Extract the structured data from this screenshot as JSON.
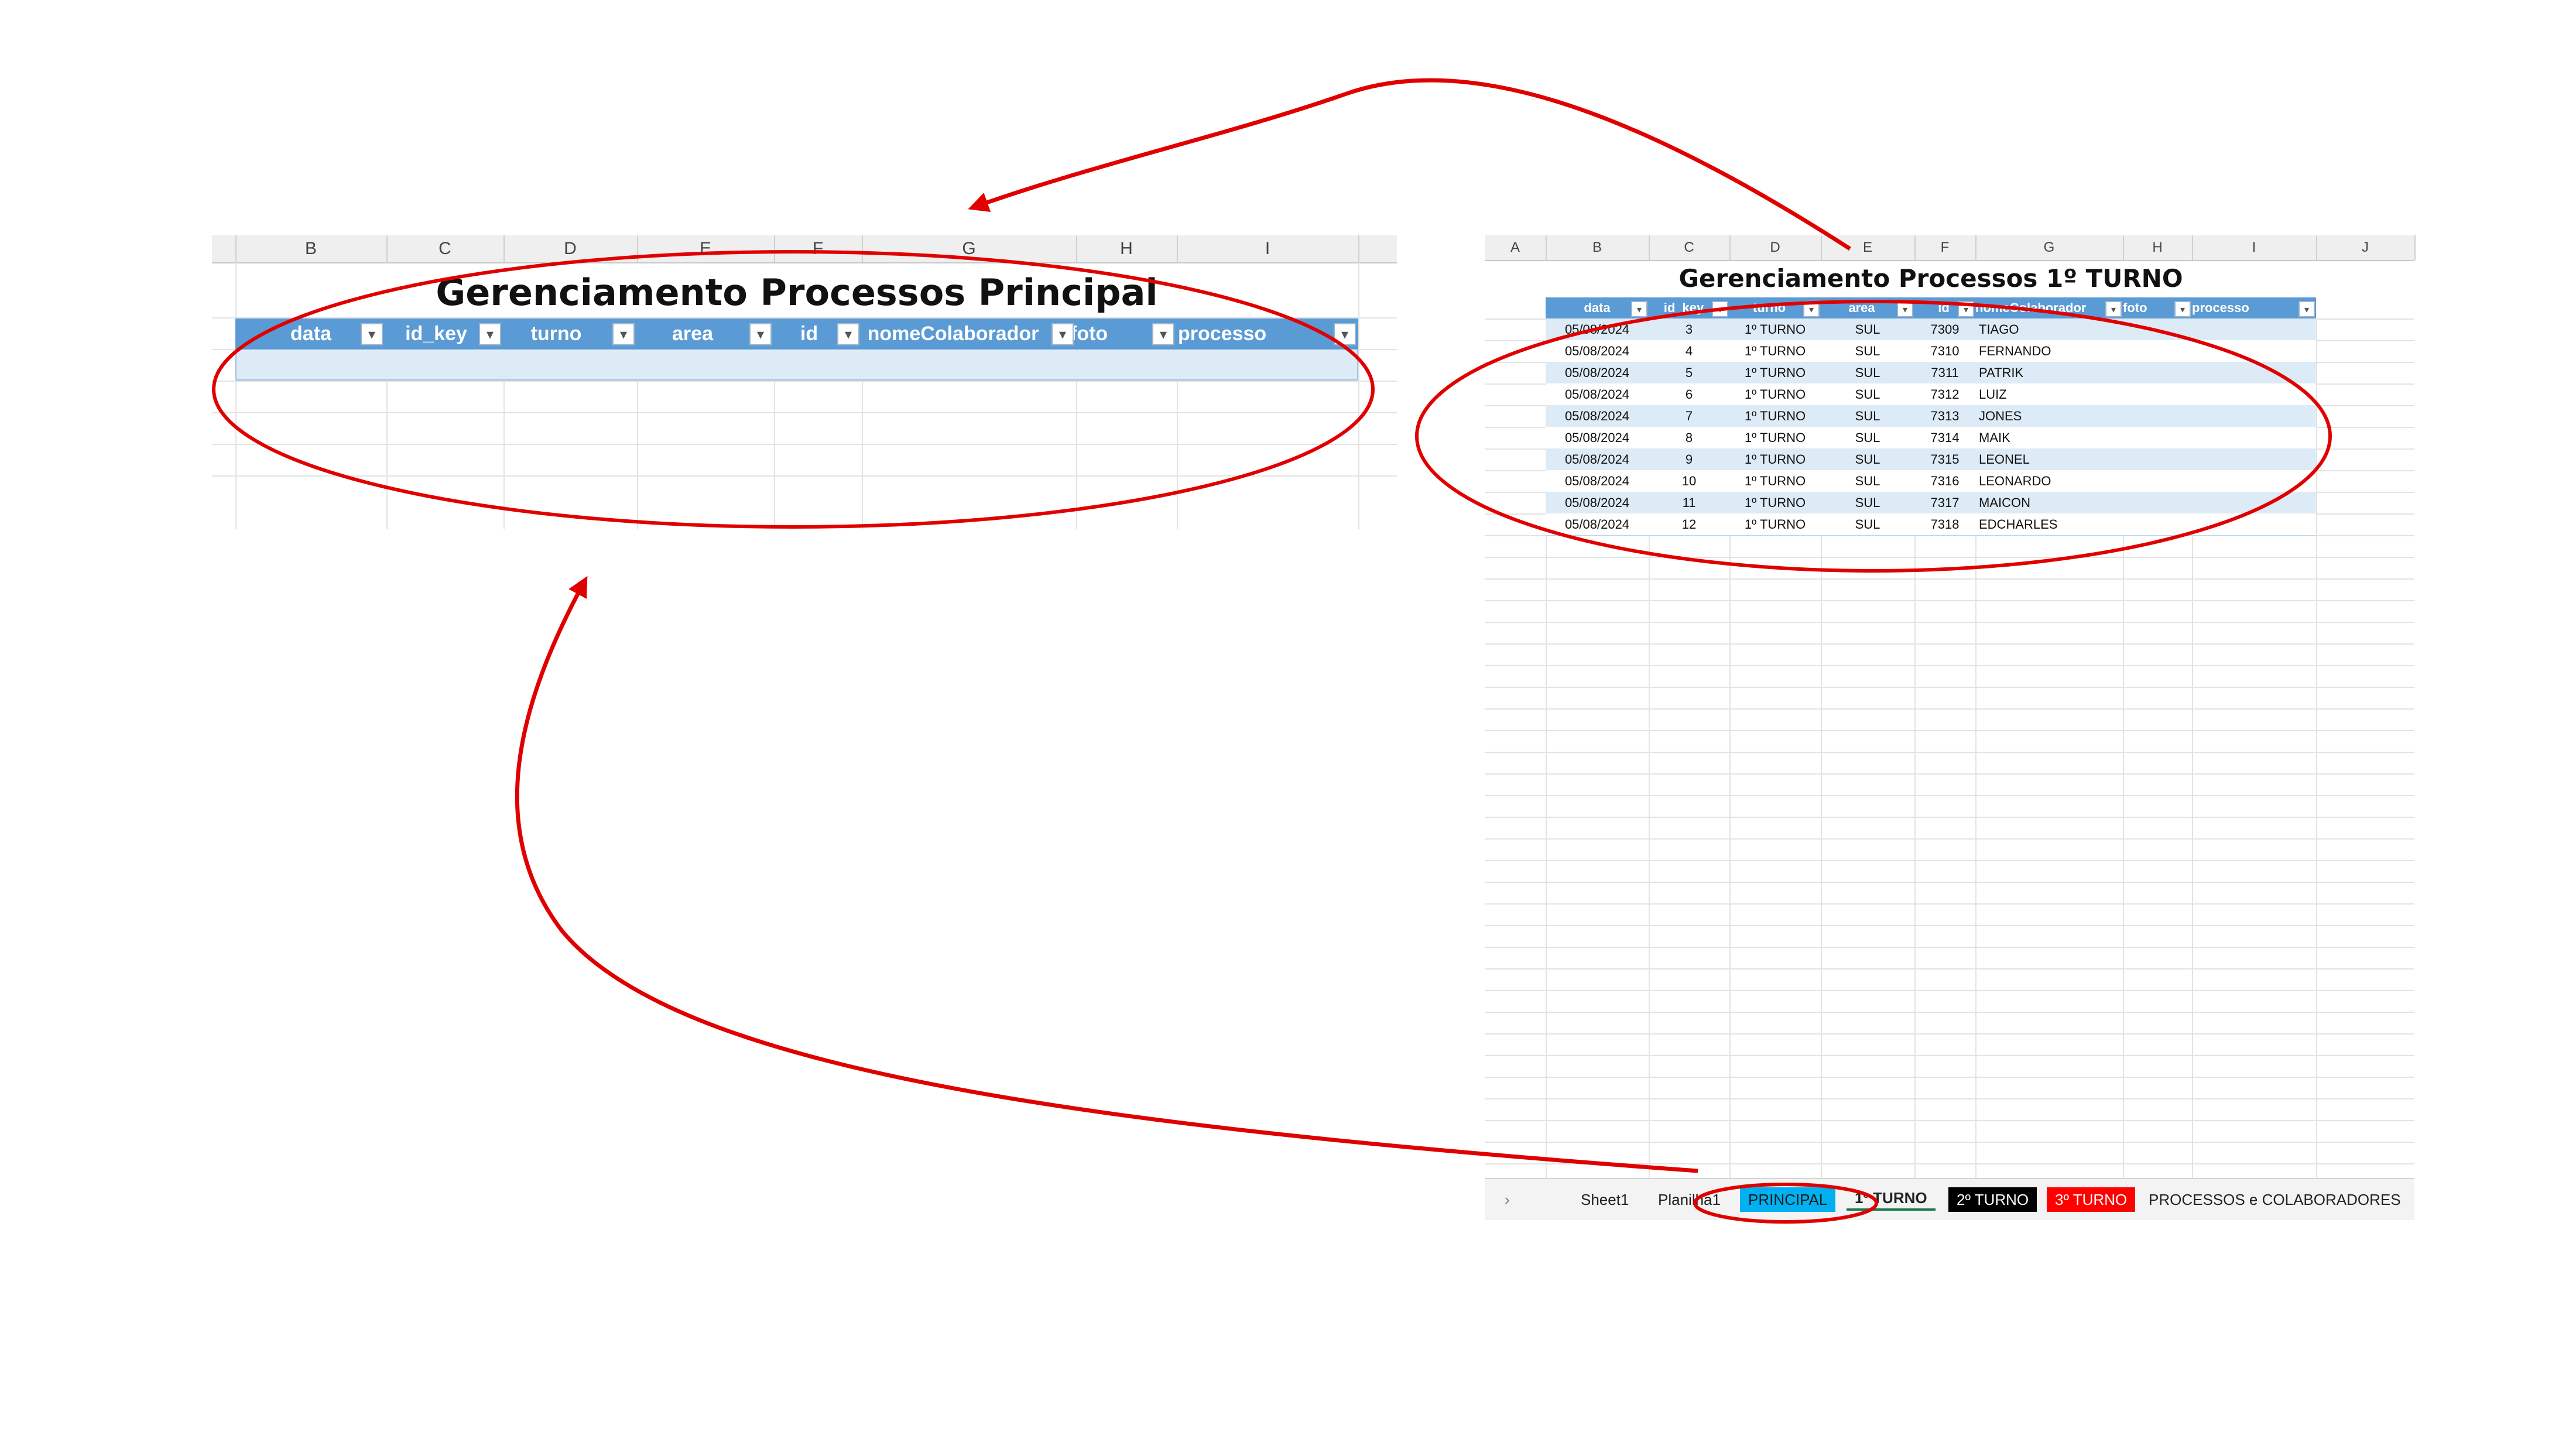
{
  "left_sheet": {
    "columns": [
      "B",
      "C",
      "D",
      "E",
      "F",
      "G",
      "H",
      "I"
    ],
    "title": "Gerenciamento Processos Principal",
    "headers": [
      "data",
      "id_key",
      "turno",
      "area",
      "id",
      "nomeColaborador",
      "foto",
      "processo"
    ],
    "filter_glyph": "▾"
  },
  "right_sheet": {
    "columns": [
      "A",
      "B",
      "C",
      "D",
      "E",
      "F",
      "G",
      "H",
      "I",
      "J"
    ],
    "title": "Gerenciamento Processos 1º TURNO",
    "headers": [
      "data",
      "id_key",
      "turno",
      "area",
      "id",
      "nomeColaborador",
      "foto",
      "processo"
    ],
    "filter_glyph": "▾",
    "rows": [
      [
        "05/08/2024",
        "3",
        "1º TURNO",
        "SUL",
        "7309",
        "TIAGO",
        "",
        ""
      ],
      [
        "05/08/2024",
        "4",
        "1º TURNO",
        "SUL",
        "7310",
        "FERNANDO",
        "",
        ""
      ],
      [
        "05/08/2024",
        "5",
        "1º TURNO",
        "SUL",
        "7311",
        "PATRIK",
        "",
        ""
      ],
      [
        "05/08/2024",
        "6",
        "1º TURNO",
        "SUL",
        "7312",
        "LUIZ",
        "",
        ""
      ],
      [
        "05/08/2024",
        "7",
        "1º TURNO",
        "SUL",
        "7313",
        "JONES",
        "",
        ""
      ],
      [
        "05/08/2024",
        "8",
        "1º TURNO",
        "SUL",
        "7314",
        "MAIK",
        "",
        ""
      ],
      [
        "05/08/2024",
        "9",
        "1º TURNO",
        "SUL",
        "7315",
        "LEONEL",
        "",
        ""
      ],
      [
        "05/08/2024",
        "10",
        "1º TURNO",
        "SUL",
        "7316",
        "LEONARDO",
        "",
        ""
      ],
      [
        "05/08/2024",
        "11",
        "1º TURNO",
        "SUL",
        "7317",
        "MAICON",
        "",
        ""
      ],
      [
        "05/08/2024",
        "12",
        "1º TURNO",
        "SUL",
        "7318",
        "EDCHARLES",
        "",
        ""
      ]
    ],
    "tabs": {
      "nav": "›",
      "sheet1": "Sheet1",
      "planilha1": "Planilha1",
      "principal": "PRINCIPAL",
      "turno1": "1º TURNO",
      "turno2": "2º TURNO",
      "turno3": "3º TURNO",
      "processos": "PROCESSOS e COLABORADORES"
    }
  },
  "colors": {
    "header_blue": "#5b9bd5",
    "band_blue": "#ddebf7",
    "annotation_red": "#e00000",
    "tab_principal": "#00b0f0",
    "tab_turno2": "#000000",
    "tab_turno3": "#ff0000"
  }
}
